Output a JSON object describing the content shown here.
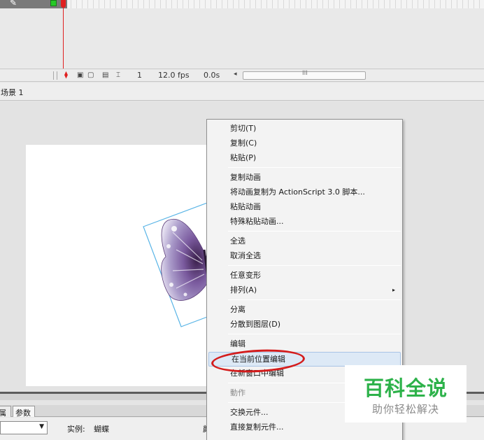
{
  "timeline": {
    "status": {
      "current_frame": "1",
      "frame_rate": "12.0 fps",
      "elapsed_time": "0.0s",
      "scroll_left_arrow": "◂",
      "scroll_grip": "III"
    }
  },
  "edit_bar": {
    "scene_label": "场景 1"
  },
  "context_menu": {
    "items": [
      {
        "label": "剪切(T)"
      },
      {
        "label": "复制(C)"
      },
      {
        "label": "粘贴(P)"
      },
      {
        "label": "复制动画"
      },
      {
        "label": "将动画复制为 ActionScript 3.0 脚本..."
      },
      {
        "label": "粘贴动画"
      },
      {
        "label": "特殊粘贴动画..."
      },
      {
        "label": "全选"
      },
      {
        "label": "取消全选"
      },
      {
        "label": "任意变形"
      },
      {
        "label": "排列(A)",
        "submenu_icon": "▸"
      },
      {
        "label": "分离"
      },
      {
        "label": "分散到图层(D)"
      },
      {
        "label": "编辑"
      },
      {
        "label": "在当前位置编辑",
        "state": "hovered"
      },
      {
        "label": "在新窗口中编辑"
      },
      {
        "label": "動作",
        "state": "disabled"
      },
      {
        "label": "交换元件..."
      },
      {
        "label": "直接复制元件..."
      }
    ]
  },
  "panel": {
    "tab_properties": "属",
    "tab_params": "参数",
    "select_arrow": "▼",
    "instance_label": "实例:",
    "instance_name": "蝴蝶",
    "color_label": "颜"
  },
  "watermark": {
    "title": "百科全说",
    "subtitle": "助你轻松解决"
  },
  "colors": {
    "playhead": "#e02020",
    "layer_color": "#27c927",
    "annotation_circle": "#d41c1c",
    "watermark_green": "#2db24a",
    "selection_box": "#58b4e6"
  }
}
